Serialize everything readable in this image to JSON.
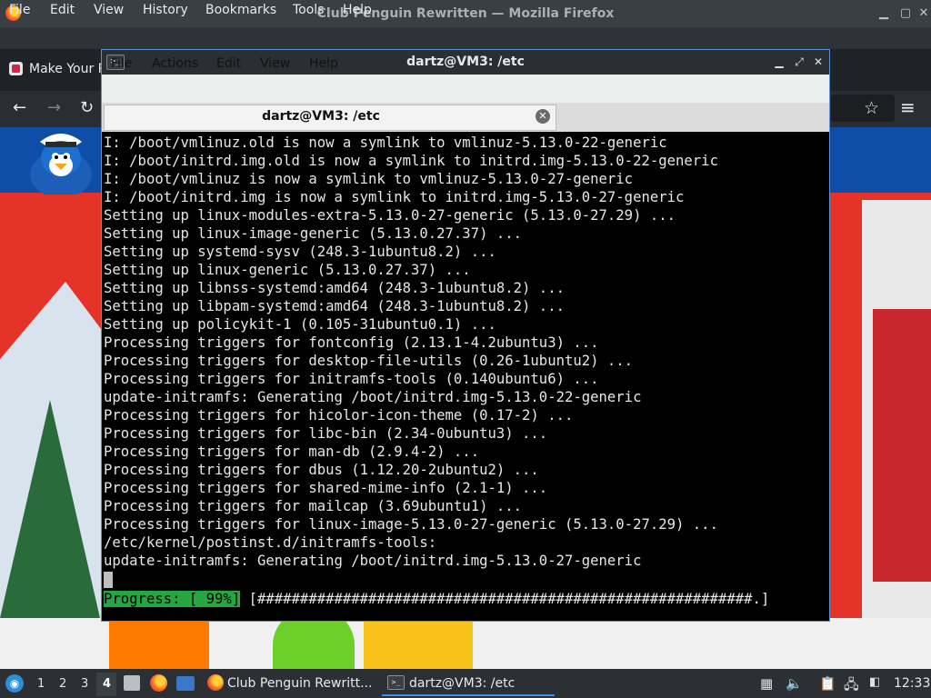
{
  "firefox": {
    "title": "Club Penguin Rewritten — Mozilla Firefox",
    "menu": [
      "File",
      "Edit",
      "View",
      "History",
      "Bookmarks",
      "Tools",
      "Help"
    ],
    "tab_label": "Make Your P",
    "icons": {
      "back": "back-arrow-icon",
      "forward": "forward-arrow-icon",
      "reload": "reload-icon",
      "bookmark": "star-icon",
      "menu": "hamburger-menu-icon"
    }
  },
  "terminal": {
    "title": "dartz@VM3: /etc",
    "menu": [
      "File",
      "Actions",
      "Edit",
      "View",
      "Help"
    ],
    "tab_label": "dartz@VM3: /etc",
    "lines": [
      "I: /boot/vmlinuz.old is now a symlink to vmlinuz-5.13.0-22-generic",
      "I: /boot/initrd.img.old is now a symlink to initrd.img-5.13.0-22-generic",
      "I: /boot/vmlinuz is now a symlink to vmlinuz-5.13.0-27-generic",
      "I: /boot/initrd.img is now a symlink to initrd.img-5.13.0-27-generic",
      "Setting up linux-modules-extra-5.13.0-27-generic (5.13.0-27.29) ...",
      "Setting up linux-image-generic (5.13.0.27.37) ...",
      "Setting up systemd-sysv (248.3-1ubuntu8.2) ...",
      "Setting up linux-generic (5.13.0.27.37) ...",
      "Setting up libnss-systemd:amd64 (248.3-1ubuntu8.2) ...",
      "Setting up libpam-systemd:amd64 (248.3-1ubuntu8.2) ...",
      "Setting up policykit-1 (0.105-31ubuntu0.1) ...",
      "Processing triggers for fontconfig (2.13.1-4.2ubuntu3) ...",
      "Processing triggers for desktop-file-utils (0.26-1ubuntu2) ...",
      "Processing triggers for initramfs-tools (0.140ubuntu6) ...",
      "update-initramfs: Generating /boot/initrd.img-5.13.0-22-generic",
      "Processing triggers for hicolor-icon-theme (0.17-2) ...",
      "Processing triggers for libc-bin (2.34-0ubuntu3) ...",
      "Processing triggers for man-db (2.9.4-2) ...",
      "Processing triggers for dbus (1.12.20-2ubuntu2) ...",
      "Processing triggers for shared-mime-info (2.1-1) ...",
      "Processing triggers for mailcap (3.69ubuntu1) ...",
      "Processing triggers for linux-image-5.13.0-27-generic (5.13.0-27.29) ...",
      "/etc/kernel/postinst.d/initramfs-tools:",
      "update-initramfs: Generating /boot/initrd.img-5.13.0-27-generic"
    ],
    "progress_label": "Progress: [ 99%]",
    "progress_bar": " [##########################################################.]",
    "progress_percent": 99
  },
  "taskbar": {
    "workspaces": [
      "1",
      "2",
      "3",
      "4"
    ],
    "active_workspace": "4",
    "tasks": [
      {
        "label": "Club Penguin Rewritt...",
        "icon": "firefox-icon"
      },
      {
        "label": "dartz@VM3: /etc",
        "icon": "terminal-icon"
      }
    ],
    "clock": "12:33"
  },
  "colors": {
    "progress_green": "#26a641",
    "terminal_bg": "#000000",
    "accent_blue": "#3d8ee6"
  }
}
